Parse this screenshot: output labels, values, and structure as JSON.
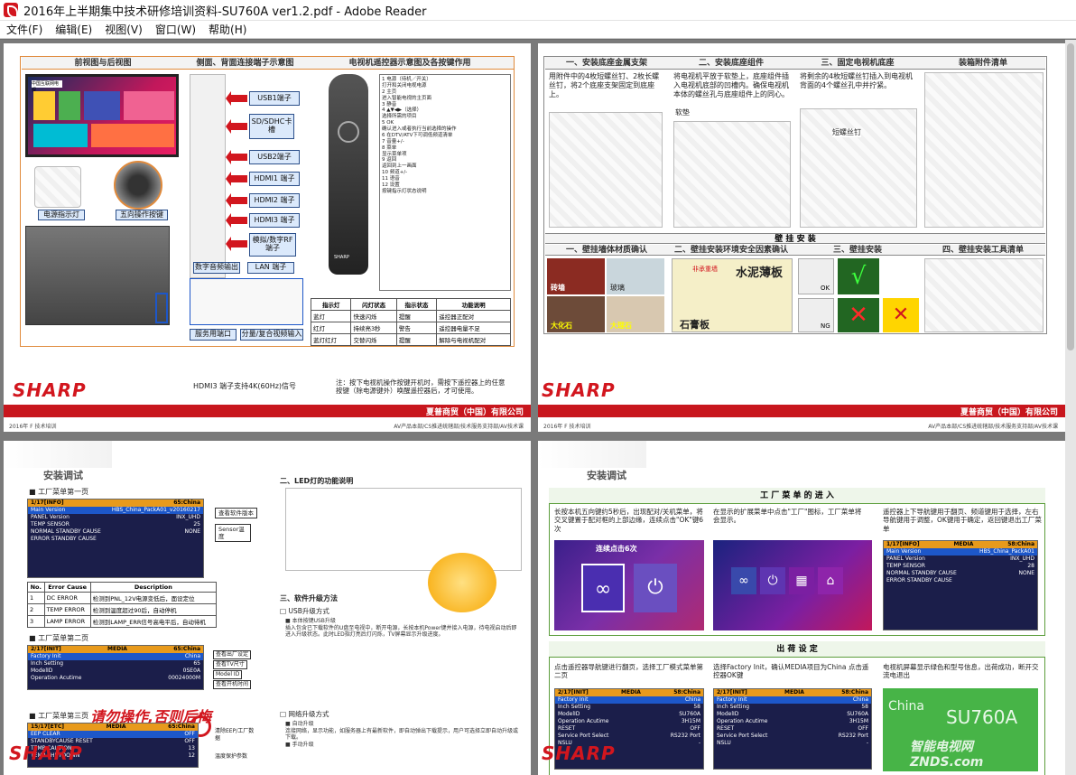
{
  "window": {
    "title": "2016年上半期集中技术研修培训资料-SU760A ver1.2.pdf - Adobe Reader"
  },
  "menu": [
    {
      "label": "文件(F)"
    },
    {
      "label": "编辑(E)"
    },
    {
      "label": "视图(V)"
    },
    {
      "label": "窗口(W)"
    },
    {
      "label": "帮助(H)"
    }
  ],
  "pages": {
    "p1": {
      "headers": [
        "前视图与后视图",
        "侧面、背面连接端子示意图",
        "电视机遥控器示意图及各按键作用"
      ],
      "front_labels": [
        "电源指示灯",
        "五向操作按键"
      ],
      "ports": [
        "USB1端子",
        "SD/SDHC卡槽",
        "USB2端子",
        "HDMI1 端子",
        "HDMI2 端子",
        "HDMI3 端子",
        "模拟/数字RF端子",
        "数字音频输出",
        "LAN 端子",
        "服务用端口",
        "分量/复合视频输入"
      ],
      "hdmi_note": "HDMI3 端子支持4K(60Hz)信号",
      "remote_note": "注：按下电视机操作按键开机时，需按下遥控器上的任意按键（除电源键外）唤醒遥控器后，才可使用。",
      "remote_table_header": [
        "指示灯",
        "闪灯状态",
        "指示状态",
        "功能说明"
      ],
      "footer_company": "夏普商贸（中国）有限公司",
      "footer_left": "2016年 F 技术培训",
      "footer_right": "AV产品本部/CS推进统辖部/技术服务支持部/AV技术课"
    },
    "p2": {
      "headers": [
        "一、安装底座金属支架",
        "二、安装底座组件",
        "三、固定电视机底座",
        "装箱附件清单"
      ],
      "texts": [
        "用附件中的4枚短螺丝钉、2枚长螺丝钉，将2个底座支架固定到底座上。",
        "将电视机平放于软垫上，底座组件插入电视机底部的凹槽内。确保电视机本体的螺丝孔与底座组件上的同心。",
        "将剩余的4枚短螺丝钉插入到电视机背面的4个螺丝孔中并拧紧。"
      ],
      "labels": [
        "软垫",
        "短螺丝钉"
      ],
      "wall_title": "壁 挂 安 装",
      "wall_headers": [
        "一、壁挂墙体材质确认",
        "二、壁挂安装环境安全因素确认",
        "三、壁挂安装",
        "四、壁挂安装工具清单"
      ],
      "wall_labels": [
        "砖墙",
        "玻璃",
        "大化石",
        "大理石",
        "石膏板",
        "水泥薄板",
        "非承重墙",
        "石膏板"
      ],
      "ok_ng": [
        "OK",
        "NG",
        "NG"
      ],
      "footer_company": "夏普商贸（中国）有限公司",
      "footer_left": "2016年 F 技术培训",
      "footer_right": "AV产品本部/CS推进统辖部/技术服务支持部/AV技术课"
    },
    "p3": {
      "title": "安装调试",
      "sections": [
        "工厂菜单第一页",
        "工厂菜单第二页",
        "工厂菜单第三页"
      ],
      "warning": "请勿操作,否则后悔",
      "led_title": "二、LED灯的功能说明",
      "soft_title": "三、软件升级方法",
      "usb_title": "□ USB升级方式",
      "net_title": "□ 网络升级方式",
      "menu1": {
        "header_left": "1/17[INFO]",
        "header_right": "65:China",
        "rows": [
          [
            "Main Version",
            "HBS_China_PackA01_v20160217"
          ],
          [
            "PANEL Version",
            "INX_UHD"
          ],
          [
            "TEMP SENSOR",
            "25"
          ],
          [
            "NORMAL STANDBY CAUSE",
            "NONE"
          ],
          [
            "ERROR STANDBY CAUSE",
            ""
          ]
        ],
        "labels": [
          "查看软件版本",
          "Sensor温度"
        ]
      },
      "error_table": {
        "header": [
          "No.",
          "Error Cause",
          "Description"
        ],
        "rows": [
          [
            "1",
            "DC ERROR",
            "检测到PNL_12V电源变低后，面设定位"
          ],
          [
            "2",
            "TEMP ERROR",
            "检测到温度超过90后，自动停机"
          ],
          [
            "3",
            "LAMP ERROR",
            "检测到LAMP_ERR信号高电平后，自动待机"
          ]
        ]
      },
      "menu2": {
        "header_left": "2/17[INIT]",
        "header_mid": "MEDIA",
        "header_right": "65:China",
        "rows": [
          [
            "Factory Init",
            "China"
          ],
          [
            "Inch Setting",
            "65"
          ],
          [
            "ModelID",
            "0SE0A"
          ],
          [
            "Operation Acutime",
            "00024000M"
          ],
          [
            "RESET",
            "OFF"
          ]
        ],
        "labels": [
          "查看出厂设定",
          "查看TV尺寸",
          "Model ID",
          "查看开机时间",
          "查看工作机时"
        ]
      },
      "menu3": {
        "header_left": "15/17[ETC]",
        "header_mid": "MEDIA",
        "header_right": "65:China",
        "rows": [
          [
            "EEP CLEAR",
            "OFF"
          ],
          [
            "STANDBYCAUSE RESET",
            "OFF"
          ],
          [
            "LAMP ERROR",
            "ON"
          ],
          [
            "TEMP CAUTION",
            "13"
          ],
          [
            "TEMP SHUTDOWN",
            "12"
          ]
        ],
        "labels": [
          "清除EEP/工厂数据",
          "温度保护参数"
        ]
      }
    },
    "p4": {
      "title": "安装调试",
      "factory_title": "工 厂 菜 单 的 进 入",
      "factory_texts": [
        "长按本机五向键约5秒后，出现配对/关机菜单，将交叉键置于配对框的上部边缘，连续点击\"OK\"键6次",
        "在显示的扩展菜单中点击\"工厂\"图标，工厂菜单将会显示。",
        "遥控器上下导航键用于翻页、频道键用于选择，左右导航键用于调整，OK键用于确定，返回键退出工厂菜单"
      ],
      "click_label": "连续点击6次",
      "shipping_title": "出 荷 设 定",
      "shipping_texts": [
        "点击遥控器导航键进行翻页，选择工厂模式菜单第二页",
        "选择Factory Init，确认MEDIA项目为China 点击遥控器OK键",
        "电视机屏幕显示绿色和型号信息，出荷成功，断开交流电退出"
      ],
      "green_screen": {
        "brand": "China",
        "model": "SU760A"
      },
      "watermark": "智能电视网 ZNDS.com",
      "small_menu": {
        "header_left": "2/17[INIT]",
        "header_mid": "MEDIA",
        "header_right": "58:China",
        "rows": [
          [
            "Factory Init",
            "China"
          ],
          [
            "Inch Setting",
            "58"
          ],
          [
            "ModelID",
            "SU760A"
          ],
          [
            "Operation Acutime",
            "3H15M"
          ],
          [
            "RESET",
            "OFF"
          ],
          [
            "Service Port Select",
            "RS232 Port"
          ],
          [
            "NSLU",
            "-"
          ]
        ]
      }
    }
  },
  "colors": {
    "sharp_red": "#d2161e",
    "frame_orange": "#e08a3c",
    "menu_navy": "#1b1e4a",
    "highlight_blue": "#1d57c9"
  }
}
